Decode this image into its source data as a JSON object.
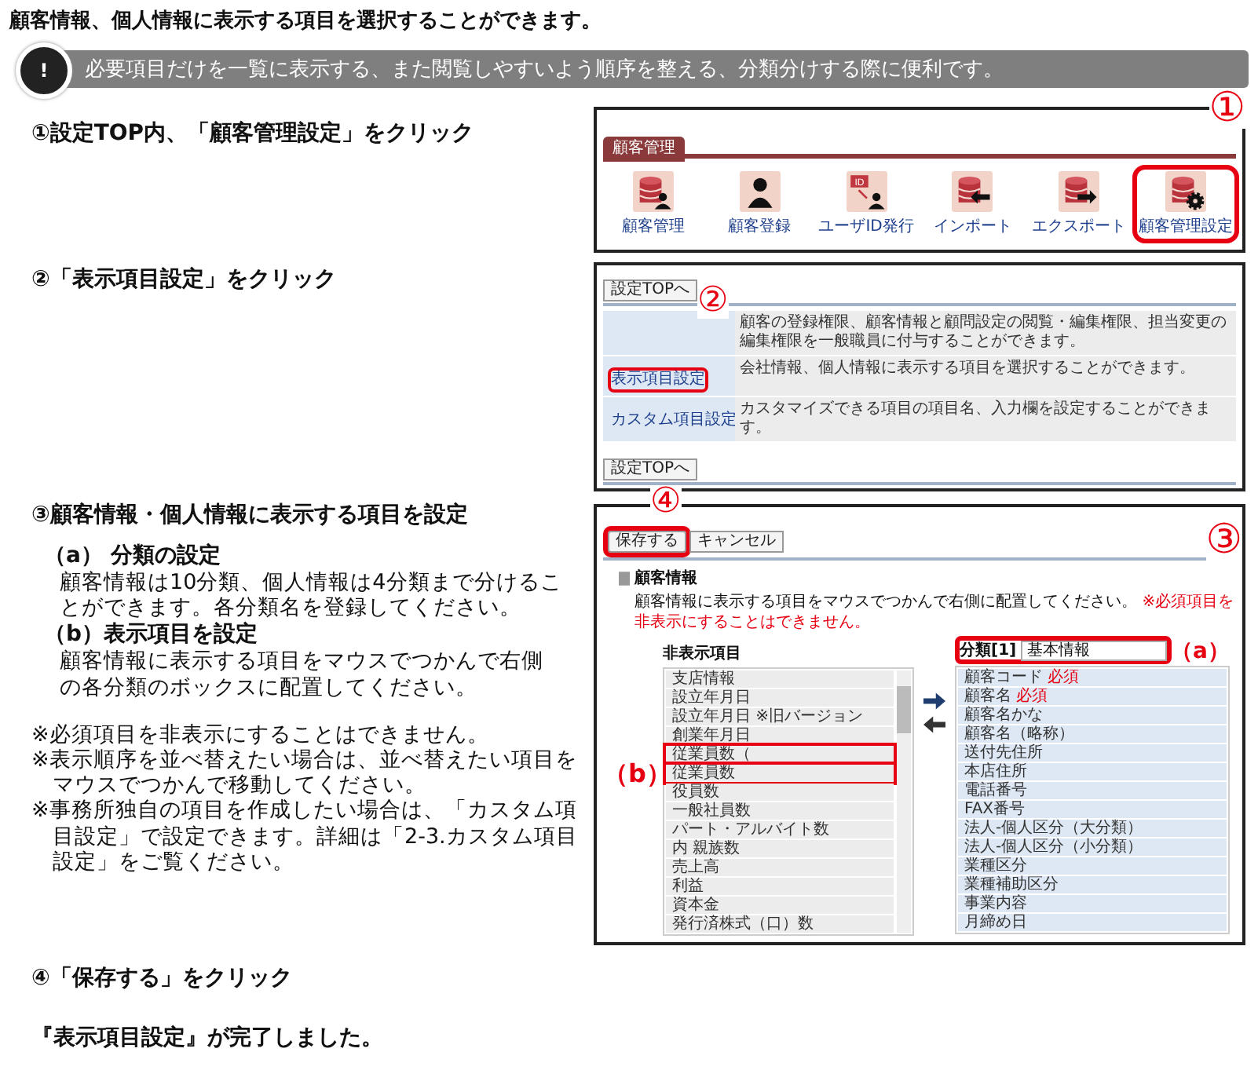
{
  "heading": "顧客情報、個人情報に表示する項目を選択することができます。",
  "note": {
    "icon": "!",
    "text": "必要項目だけを一覧に表示する、また閲覧しやすいよう順序を整える、分類分けする際に便利です。"
  },
  "step1": {
    "text": "①設定TOP内、「顧客管理設定」をクリック",
    "panel": {
      "marker": "①",
      "tab": "顧客管理",
      "tools": [
        {
          "label": "顧客管理",
          "kind": "db-user",
          "highlighted": false
        },
        {
          "label": "顧客登録",
          "kind": "user",
          "highlighted": false
        },
        {
          "label": "ユーザID発行",
          "kind": "id-user",
          "badge": "ID",
          "highlighted": false
        },
        {
          "label": "インポート",
          "kind": "db-import",
          "highlighted": false
        },
        {
          "label": "エクスポート",
          "kind": "db-export",
          "highlighted": false
        },
        {
          "label": "顧客管理設定",
          "kind": "db-gear",
          "highlighted": true
        }
      ]
    }
  },
  "step2": {
    "text": "②「表示項目設定」をクリック",
    "panel": {
      "marker": "②",
      "top_button": "設定TOPへ",
      "rows": [
        {
          "description": "顧客の登録権限、顧客情報と顧問設定の閲覧・編集権限、担当変更の編集権限を一般職員に付与することができます。"
        },
        {
          "label": "表示項目設定",
          "description": "会社情報、個人情報に表示する項目を選択することができます。",
          "highlighted": true
        },
        {
          "label": "カスタム項目設定",
          "description": "カスタマイズできる項目の項目名、入力欄を設定することができます。",
          "highlighted": false
        }
      ],
      "bottom_button": "設定TOPへ"
    }
  },
  "step3": {
    "text": "③顧客情報・個人情報に表示する項目を設定",
    "sub": [
      {
        "title": "（a） 分類の設定",
        "body": "顧客情報は10分類、個人情報は4分類まで分けることができます。各分類名を登録してください。"
      },
      {
        "title": "（b）表示項目を設定",
        "body": "顧客情報に表示する項目をマウスでつかんで右側の各分類のボックスに配置してください。"
      }
    ],
    "notes": [
      "※必須項目を非表示にすることはできません。",
      "※表示順序を並べ替えたい場合は、並べ替えたい項目をマウスでつかんで移動してください。",
      "※事務所独自の項目を作成したい場合は、「カスタム項目設定」で設定できます。詳細は「2-3.カスタム項目設定」をご覧ください。"
    ],
    "panel": {
      "marker": "③",
      "save_marker": "④",
      "buttons": [
        {
          "label": "保存する",
          "highlighted": true
        },
        {
          "label": "キャンセル",
          "highlighted": false
        }
      ],
      "title": "顧客情報",
      "instruction": "顧客情報に表示する項目をマウスでつかんで右側に配置してください。",
      "warning": "※必須項目を非表示にすることはできません。",
      "hidden_header": "非表示項目",
      "b_marker": "（b）",
      "a_marker": "（a）",
      "hidden_items": [
        {
          "label": "支店情報",
          "highlighted": false
        },
        {
          "label": "設立年月日",
          "highlighted": false
        },
        {
          "label": "設立年月日 ※旧バージョン",
          "highlighted": false
        },
        {
          "label": "創業年月日",
          "highlighted": false
        },
        {
          "label": "従業員数（",
          "highlighted": true
        },
        {
          "label": "従業員数",
          "highlighted": true
        },
        {
          "label": "役員数",
          "highlighted": false
        },
        {
          "label": "一般社員数",
          "highlighted": false
        },
        {
          "label": "パート・アルバイト数",
          "highlighted": false
        },
        {
          "label": "内 親族数",
          "highlighted": false
        },
        {
          "label": "売上高",
          "highlighted": false
        },
        {
          "label": "利益",
          "highlighted": false
        },
        {
          "label": "資本金",
          "highlighted": false
        },
        {
          "label": "発行済株式（口）数",
          "highlighted": false
        }
      ],
      "category": {
        "label": "分類[1]",
        "value": "基本情報",
        "highlighted": true
      },
      "shown_items": [
        {
          "label": "顧客コード",
          "badge": "必須"
        },
        {
          "label": "顧客名",
          "badge": "必須"
        },
        {
          "label": "顧客名かな"
        },
        {
          "label": "顧客名（略称）"
        },
        {
          "label": "送付先住所"
        },
        {
          "label": "本店住所"
        },
        {
          "label": "電話番号"
        },
        {
          "label": "FAX番号"
        },
        {
          "label": "法人-個人区分（大分類）"
        },
        {
          "label": "法人-個人区分（小分類）"
        },
        {
          "label": "業種区分"
        },
        {
          "label": "業種補助区分"
        },
        {
          "label": "事業内容"
        },
        {
          "label": "月締め日"
        }
      ]
    }
  },
  "step4": {
    "text": "④「保存する」をクリック"
  },
  "done": "『表示項目設定』が完了しました。"
}
